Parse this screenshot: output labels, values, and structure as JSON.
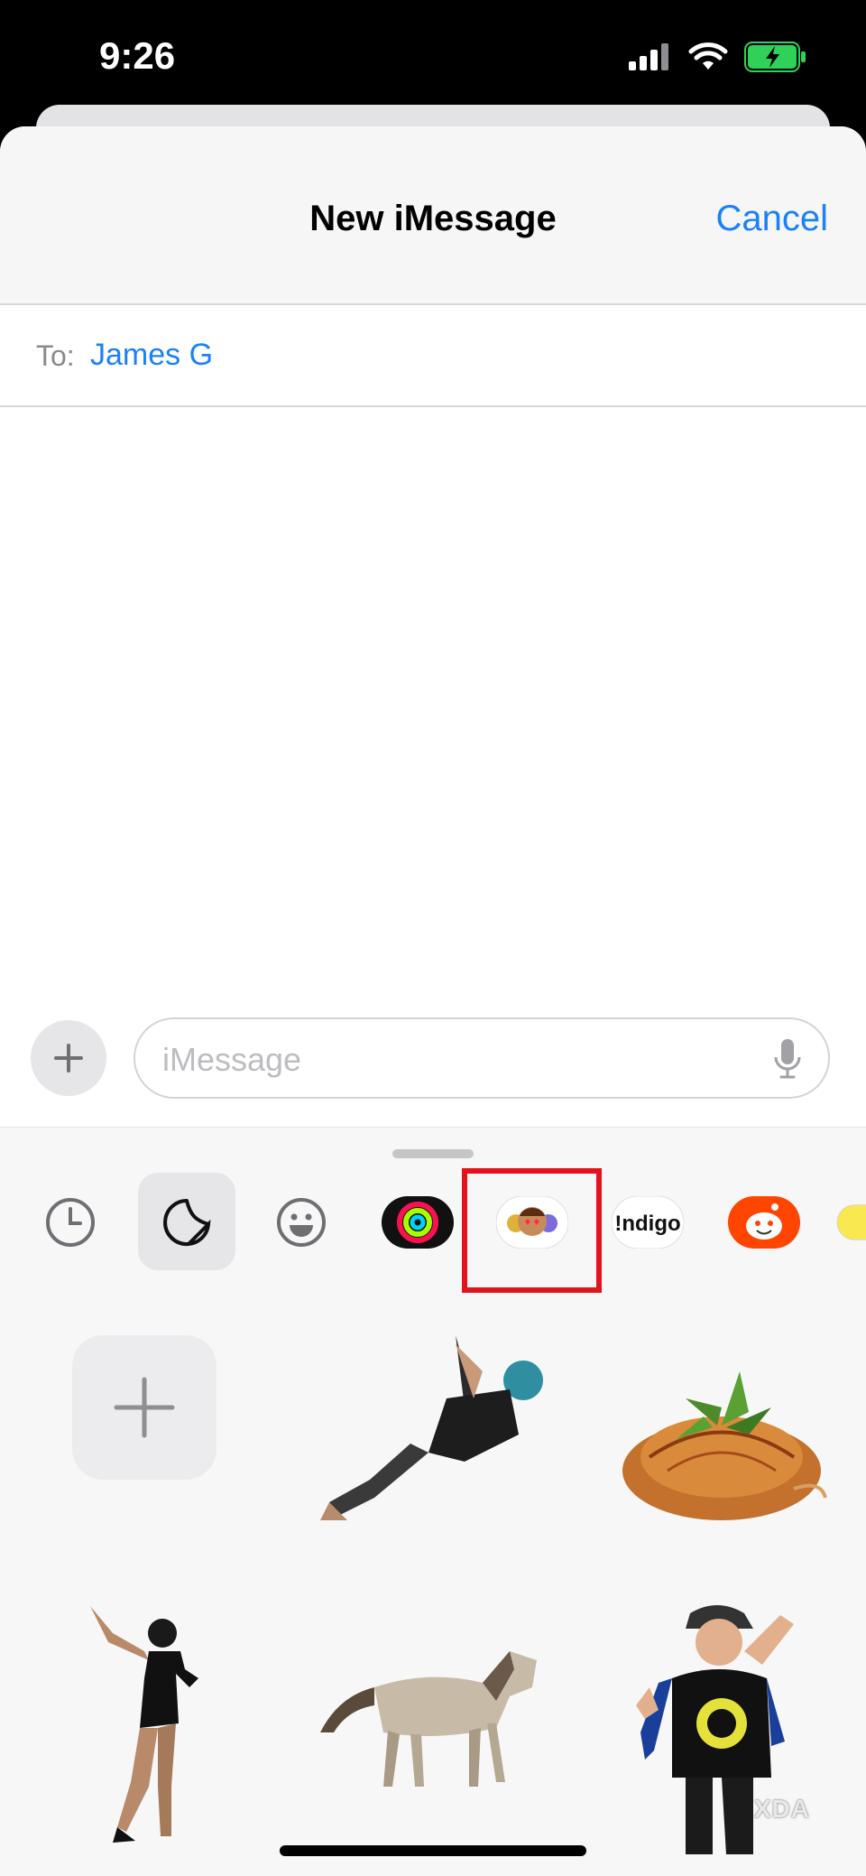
{
  "status": {
    "time": "9:26",
    "battery_color": "#30d158"
  },
  "nav": {
    "title": "New iMessage",
    "cancel_label": "Cancel"
  },
  "recipient": {
    "label": "To:",
    "value": "James G"
  },
  "compose": {
    "placeholder": "iMessage"
  },
  "apps": [
    {
      "name": "recents",
      "icon": "clock-icon"
    },
    {
      "name": "stickers",
      "icon": "sticker-icon",
      "selected": true
    },
    {
      "name": "emoji",
      "icon": "smiley-icon"
    },
    {
      "name": "activity",
      "icon": "activity-rings-icon"
    },
    {
      "name": "memoji",
      "icon": "memoji-icon",
      "highlighted": true
    },
    {
      "name": "indigo",
      "label": "!ndigo"
    },
    {
      "name": "reddit",
      "icon": "reddit-icon"
    },
    {
      "name": "more",
      "icon": "partial-app-icon"
    }
  ],
  "stickers": [
    {
      "name": "add",
      "icon": "plus-icon"
    },
    {
      "name": "climber",
      "description": "person climbing"
    },
    {
      "name": "pasta",
      "description": "spaghetti with basil"
    },
    {
      "name": "dancer",
      "description": "woman dancing"
    },
    {
      "name": "horse",
      "description": "horse walking"
    },
    {
      "name": "boy",
      "description": "boy with cap"
    }
  ],
  "watermark": "XDA",
  "colors": {
    "accent": "#1a82f6",
    "highlight": "#e2131c"
  }
}
